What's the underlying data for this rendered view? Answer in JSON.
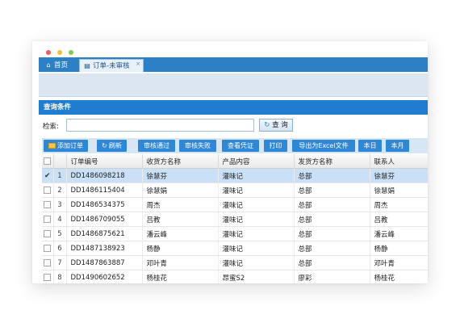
{
  "window_controls": [
    "close",
    "minimize",
    "maximize"
  ],
  "tabs": [
    {
      "label": "首页",
      "icon": "home-icon",
      "active": false
    },
    {
      "label": "订单-未审核",
      "icon": "document-icon",
      "active": true,
      "close": "×"
    }
  ],
  "section_title": "查询条件",
  "search": {
    "label": "检索:",
    "value": "",
    "placeholder": "",
    "button_label": "查 询"
  },
  "toolbar": {
    "add": "添加订单",
    "refresh": "刷新",
    "approve": "审核通过",
    "reject": "审核失败",
    "view_voucher": "查看凭证",
    "print": "打印",
    "export": "导出为Excel文件",
    "today": "本日",
    "this_month": "本月"
  },
  "table": {
    "columns": [
      "",
      "",
      "订单编号",
      "收货方名称",
      "产品内容",
      "发货方名称",
      "联系人"
    ],
    "rows": [
      {
        "num": "1",
        "order_no": "DD1486098218",
        "receiver": "徐慧芬",
        "product": "灌味记",
        "sender": "总部",
        "contact": "徐慧芬",
        "selected": true
      },
      {
        "num": "2",
        "order_no": "DD1486115404",
        "receiver": "徐慧娟",
        "product": "灌味记",
        "sender": "总部",
        "contact": "徐慧娟",
        "selected": false
      },
      {
        "num": "3",
        "order_no": "DD1486534375",
        "receiver": "周杰",
        "product": "灌味记",
        "sender": "总部",
        "contact": "周杰",
        "selected": false
      },
      {
        "num": "4",
        "order_no": "DD1486709055",
        "receiver": "吕教",
        "product": "灌味记",
        "sender": "总部",
        "contact": "吕教",
        "selected": false
      },
      {
        "num": "5",
        "order_no": "DD1486875621",
        "receiver": "潘云峰",
        "product": "灌味记",
        "sender": "总部",
        "contact": "潘云峰",
        "selected": false
      },
      {
        "num": "6",
        "order_no": "DD1487138923",
        "receiver": "杨静",
        "product": "灌味记",
        "sender": "总部",
        "contact": "杨静",
        "selected": false
      },
      {
        "num": "7",
        "order_no": "DD1487863887",
        "receiver": "邓叶青",
        "product": "灌味记",
        "sender": "总部",
        "contact": "邓叶青",
        "selected": false
      },
      {
        "num": "8",
        "order_no": "DD1490602652",
        "receiver": "杨桂花",
        "product": "昂蜜S2",
        "sender": "廖彩",
        "contact": "杨桂花",
        "selected": false
      }
    ]
  },
  "colors": {
    "accent": "#2b80c6",
    "header": "#1f7ccf",
    "selected_row": "#c9e0f7"
  }
}
